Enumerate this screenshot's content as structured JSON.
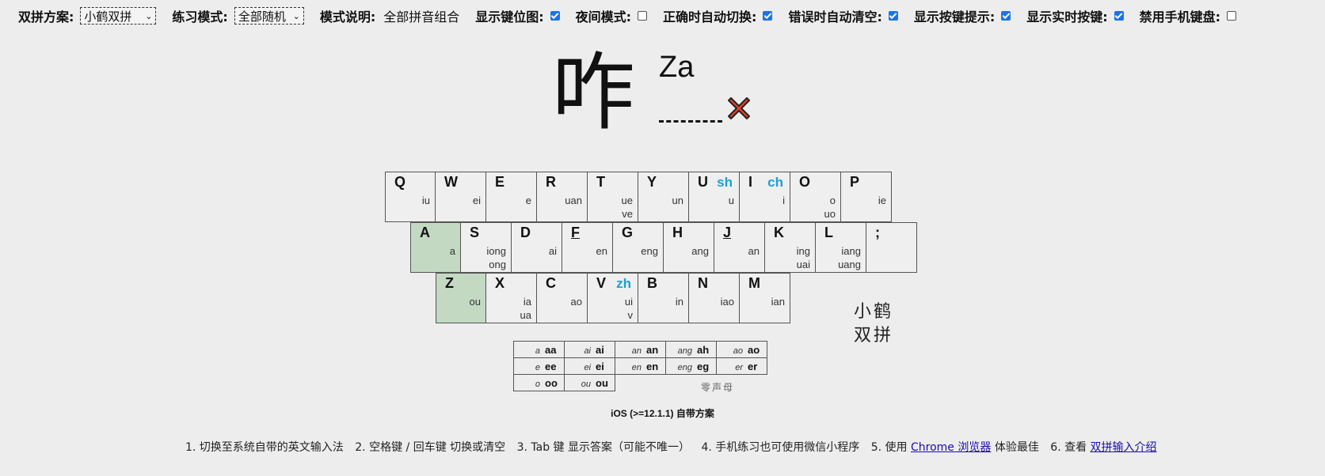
{
  "toolbar": {
    "scheme_label": "双拼方案:",
    "scheme_value": "小鹤双拼",
    "mode_label": "练习模式:",
    "mode_value": "全部随机",
    "desc_label": "模式说明:",
    "desc_value": "全部拼音组合",
    "opt_keymap": "显示键位图:",
    "opt_night": "夜间模式:",
    "opt_auto_switch": "正确时自动切换:",
    "opt_auto_clear": "错误时自动清空:",
    "opt_key_hint": "显示按键提示:",
    "opt_live_keys": "显示实时按键:",
    "opt_no_mobile_kb": "禁用手机键盘:"
  },
  "practice": {
    "char": "咋",
    "pinyin": "Za"
  },
  "keyboard": {
    "rows": [
      [
        {
          "k": "Q",
          "f1": "iu"
        },
        {
          "k": "W",
          "f1": "ei"
        },
        {
          "k": "E",
          "f1": "e"
        },
        {
          "k": "R",
          "f1": "uan"
        },
        {
          "k": "T",
          "f1": "ue",
          "f2": "ve"
        },
        {
          "k": "Y",
          "f1": "un"
        },
        {
          "k": "U",
          "sh": "sh",
          "f1": "u"
        },
        {
          "k": "I",
          "sh": "ch",
          "f1": "i"
        },
        {
          "k": "O",
          "f1": "o",
          "f2": "uo"
        },
        {
          "k": "P",
          "f1": "ie"
        }
      ],
      [
        {
          "k": "A",
          "f1": "a",
          "hl": true
        },
        {
          "k": "S",
          "f1": "iong",
          "f2": "ong"
        },
        {
          "k": "D",
          "f1": "ai"
        },
        {
          "k": "F",
          "f1": "en",
          "u": true
        },
        {
          "k": "G",
          "f1": "eng"
        },
        {
          "k": "H",
          "f1": "ang"
        },
        {
          "k": "J",
          "f1": "an",
          "u": true
        },
        {
          "k": "K",
          "f1": "ing",
          "f2": "uai"
        },
        {
          "k": "L",
          "f1": "iang",
          "f2": "uang"
        },
        {
          "k": ";"
        }
      ],
      [
        {
          "k": "Z",
          "f1": "ou",
          "hl": true
        },
        {
          "k": "X",
          "f1": "ia",
          "f2": "ua"
        },
        {
          "k": "C",
          "f1": "ao"
        },
        {
          "k": "V",
          "sh": "zh",
          "f1": "ui",
          "f2": "v"
        },
        {
          "k": "B",
          "f1": "in"
        },
        {
          "k": "N",
          "f1": "iao"
        },
        {
          "k": "M",
          "f1": "ian"
        }
      ]
    ],
    "brand_line1": "小鹤",
    "brand_line2": "双拼"
  },
  "zero": {
    "rows": [
      [
        {
          "a": "a",
          "b": "aa"
        },
        {
          "a": "ai",
          "b": "ai"
        },
        {
          "a": "an",
          "b": "an"
        },
        {
          "a": "ang",
          "b": "ah"
        },
        {
          "a": "ao",
          "b": "ao"
        }
      ],
      [
        {
          "a": "e",
          "b": "ee"
        },
        {
          "a": "ei",
          "b": "ei"
        },
        {
          "a": "en",
          "b": "en"
        },
        {
          "a": "eng",
          "b": "eg"
        },
        {
          "a": "er",
          "b": "er"
        }
      ],
      [
        {
          "a": "o",
          "b": "oo"
        },
        {
          "a": "ou",
          "b": "ou"
        }
      ]
    ],
    "label": "零声母"
  },
  "caption": "iOS (>=12.1.1) 自带方案",
  "tips": {
    "t1": "1. 切换至系统自带的英文输入法",
    "t2": "2. 空格键 / 回车键 切换或清空",
    "t3": "3. Tab 键 显示答案（可能不唯一）",
    "t4": "4. 手机练习也可使用微信小程序",
    "t5a": "5. 使用",
    "t5link": "Chrome 浏览器",
    "t5b": "体验最佳",
    "t6a": "6. 查看",
    "t6link": "双拼输入介绍"
  },
  "colors": {
    "highlight": "#c3d9c2",
    "shengmu": "#1aa0d8",
    "wrong": "#e8402a"
  }
}
